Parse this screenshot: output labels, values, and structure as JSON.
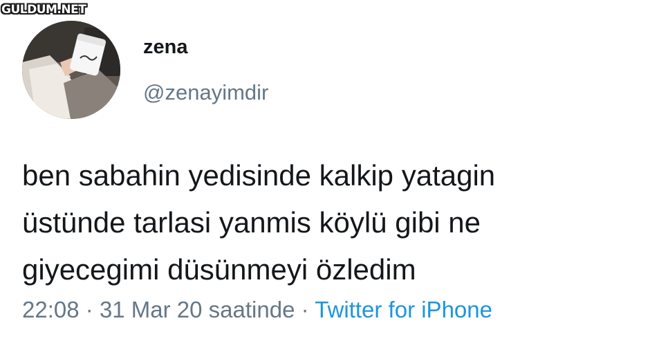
{
  "watermark": "GULDUM.NET",
  "user": {
    "name": "zena",
    "handle": "@zenayimdir"
  },
  "tweet": {
    "lines": [
      "ben sabahin yedisinde kalkip yatagin",
      "üstünde tarlasi yanmis köylü gibi ne",
      "giyecegimi düsünmeyi özledim"
    ],
    "time": "22:08",
    "separator": "·",
    "date": "31 Mar 20 saatinde",
    "source": "Twitter for iPhone"
  },
  "colors": {
    "text": "#14171a",
    "secondary": "#657786",
    "link": "#1b95e0"
  }
}
